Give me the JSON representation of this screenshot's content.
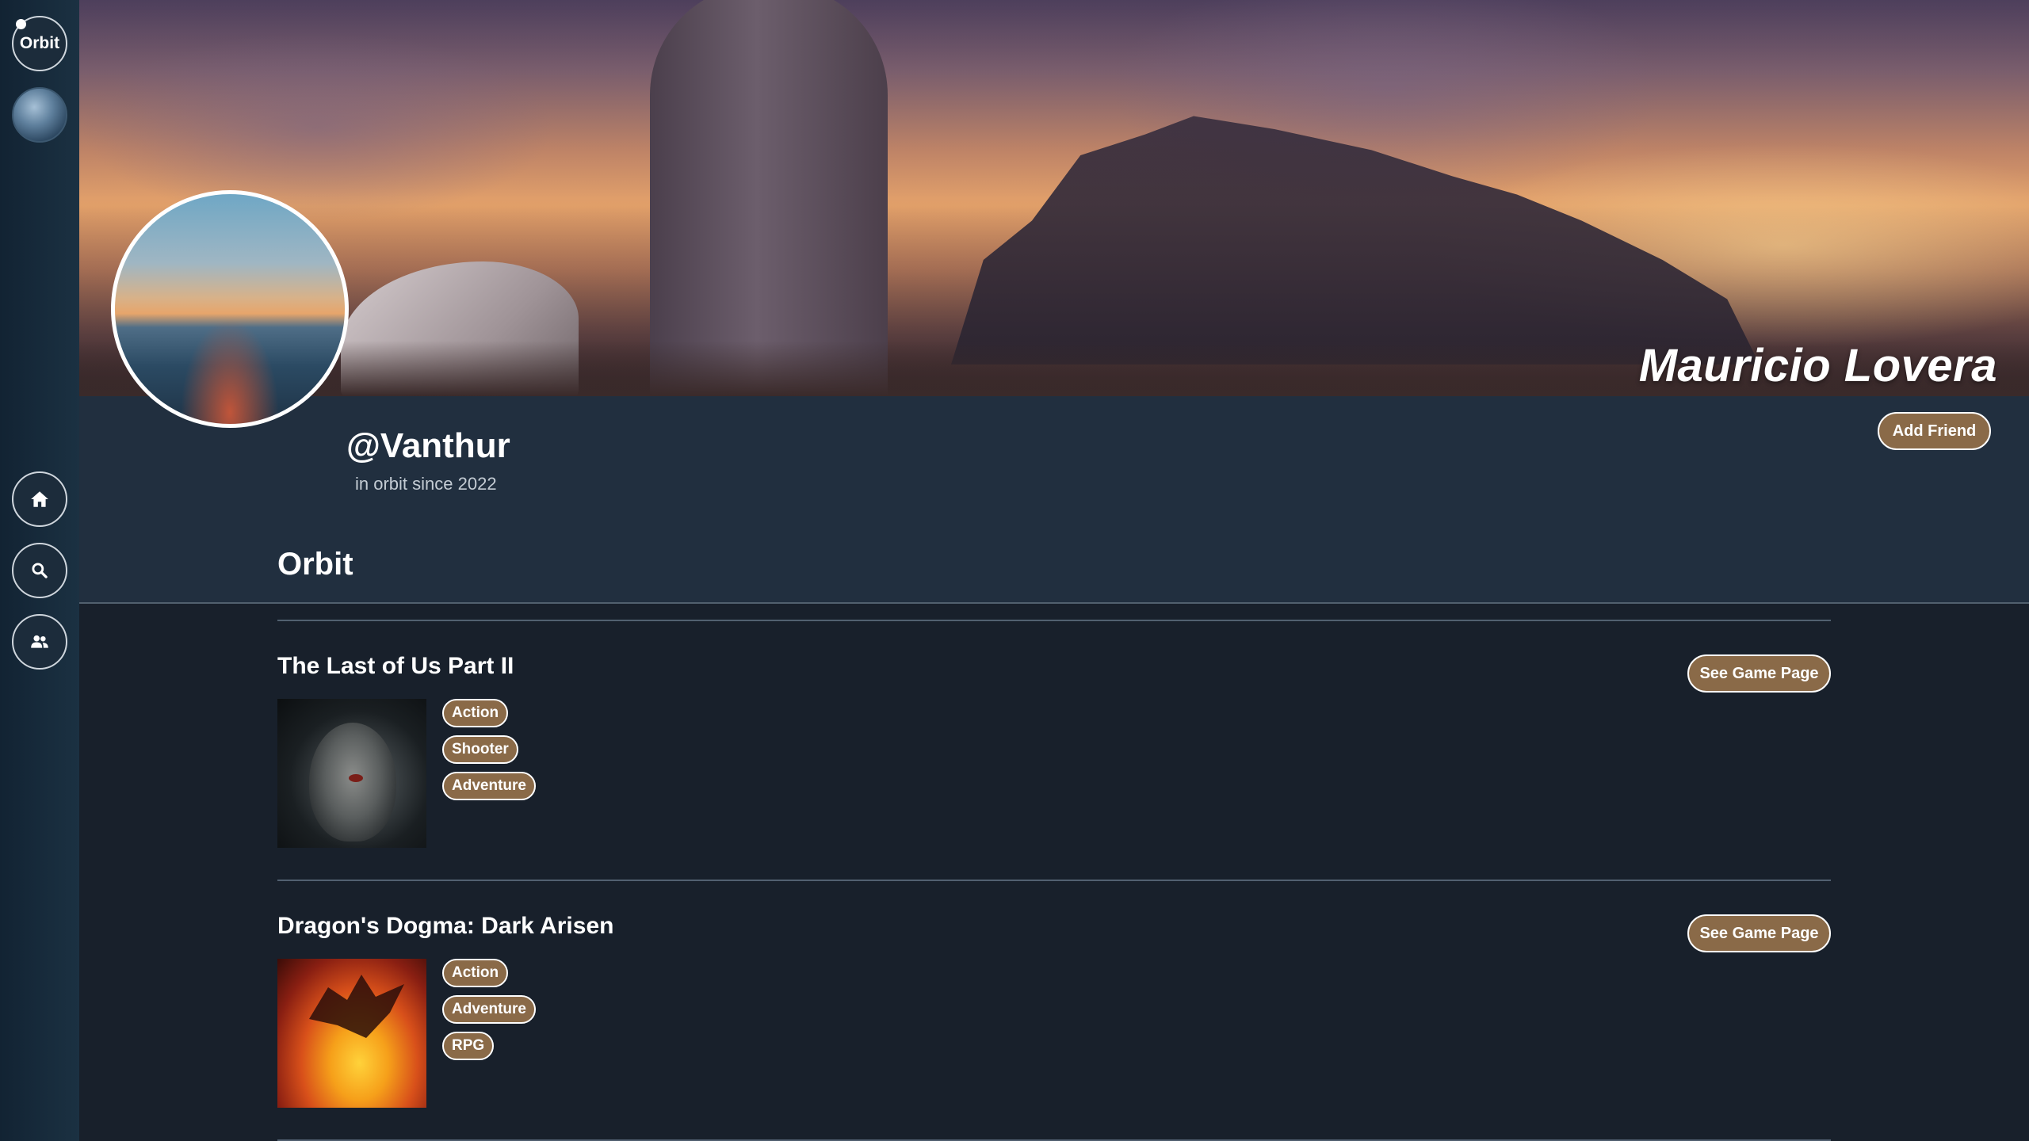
{
  "sidebar": {
    "logo_text": "Orbit",
    "items": [
      {
        "name": "home",
        "icon": "home-icon"
      },
      {
        "name": "search",
        "icon": "search-icon"
      },
      {
        "name": "friends",
        "icon": "friends-icon"
      }
    ]
  },
  "banner": {
    "display_name": "Mauricio Lovera"
  },
  "profile": {
    "handle": "@Vanthur",
    "since": "in orbit since 2022",
    "add_friend_label": "Add Friend"
  },
  "orbit_section": {
    "heading": "Orbit"
  },
  "games": [
    {
      "title": "The Last of Us Part II",
      "tags": [
        "Action",
        "Shooter",
        "Adventure"
      ],
      "button_label": "See Game Page"
    },
    {
      "title": "Dragon's Dogma: Dark Arisen",
      "tags": [
        "Action",
        "Adventure",
        "RPG"
      ],
      "button_label": "See Game Page"
    }
  ],
  "colors": {
    "accent": "#8a6a48",
    "background": "#18202b",
    "header_background": "#212f3f",
    "sidebar": "#122333"
  }
}
